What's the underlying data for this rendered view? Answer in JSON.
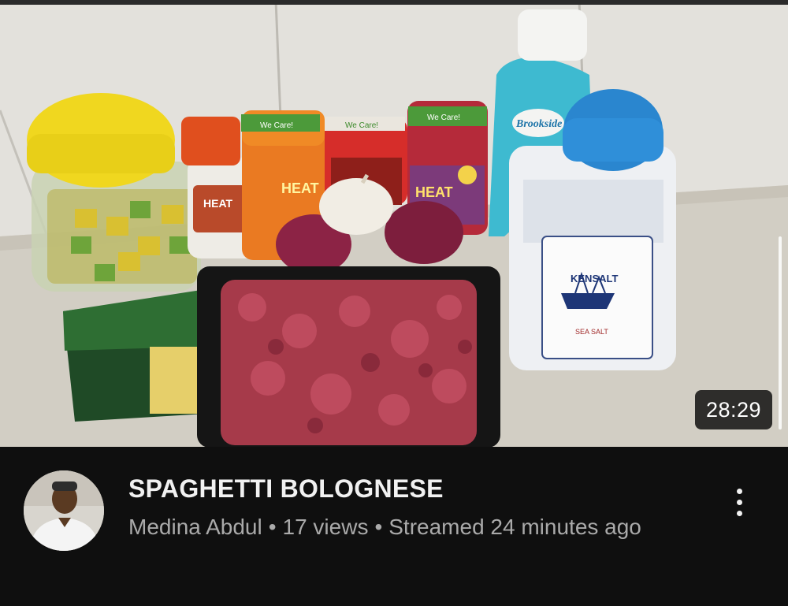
{
  "video": {
    "thumbnail_icon": "video-thumbnail-image",
    "duration": "28:29",
    "title": "SPAGHETTI BOLOGNESE",
    "channel": "Medina Abdul",
    "separator": "•",
    "views": "17 views",
    "streamed": "Streamed 24 minutes ago",
    "more_icon": "more-vertical-icon"
  },
  "thumbnail_labels": {
    "jar_label_1": "We Care!",
    "jar_label_2": "We Care!",
    "jar_label_3": "We Care!",
    "spice_name_1": "HEAT",
    "spice_name_2": "HEAT",
    "spice_name_3": "HEAT",
    "milk_brand": "Brookside",
    "salt_brand": "KENSALT",
    "salt_type": "SEA SALT"
  },
  "colors": {
    "background": "#0f0f0f",
    "title": "#f1f1f1",
    "subtitle": "#aaaaaa"
  }
}
